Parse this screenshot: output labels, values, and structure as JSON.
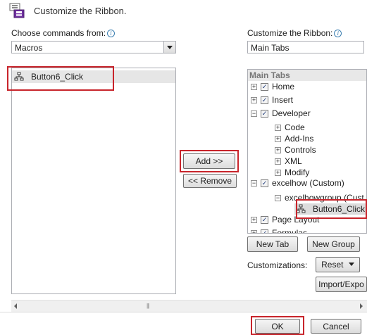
{
  "dialog": {
    "title": "Customize the Ribbon."
  },
  "left": {
    "label": "Choose commands from:",
    "dropdown_value": "Macros",
    "list_items": [
      "Button6_Click"
    ]
  },
  "right": {
    "label": "Customize the Ribbon:",
    "dropdown_value": "Main Tabs",
    "tree_header": "Main Tabs",
    "tree": [
      {
        "label": "Home",
        "expander": "+",
        "checked": true
      },
      {
        "label": "Insert",
        "expander": "+",
        "checked": true
      },
      {
        "label": "Developer",
        "expander": "−",
        "checked": true
      },
      {
        "label": "Code",
        "expander": "+"
      },
      {
        "label": "Add-Ins",
        "expander": "+"
      },
      {
        "label": "Controls",
        "expander": "+"
      },
      {
        "label": "XML",
        "expander": "+"
      },
      {
        "label": "Modify",
        "expander": "+"
      },
      {
        "label": "excelhow (Custom)",
        "expander": "−",
        "checked": true
      },
      {
        "label": "excelhowgroup (Cust",
        "expander": "−"
      },
      {
        "label": "Button6_Click"
      },
      {
        "label": "Page Layout",
        "expander": "+",
        "checked": true
      },
      {
        "label": "Formulas",
        "expander": "+",
        "checked": true
      }
    ]
  },
  "buttons": {
    "add": "Add >>",
    "remove": "<< Remove",
    "new_tab": "New Tab",
    "new_group": "New Group",
    "reset": "Reset",
    "import_export": "Import/Expo",
    "ok": "OK",
    "cancel": "Cancel"
  },
  "customizations_label": "Customizations:",
  "colors": {
    "highlight_border": "#c8242b",
    "selected_row": "#e6e6e6",
    "accent": "#3c7fb1"
  }
}
